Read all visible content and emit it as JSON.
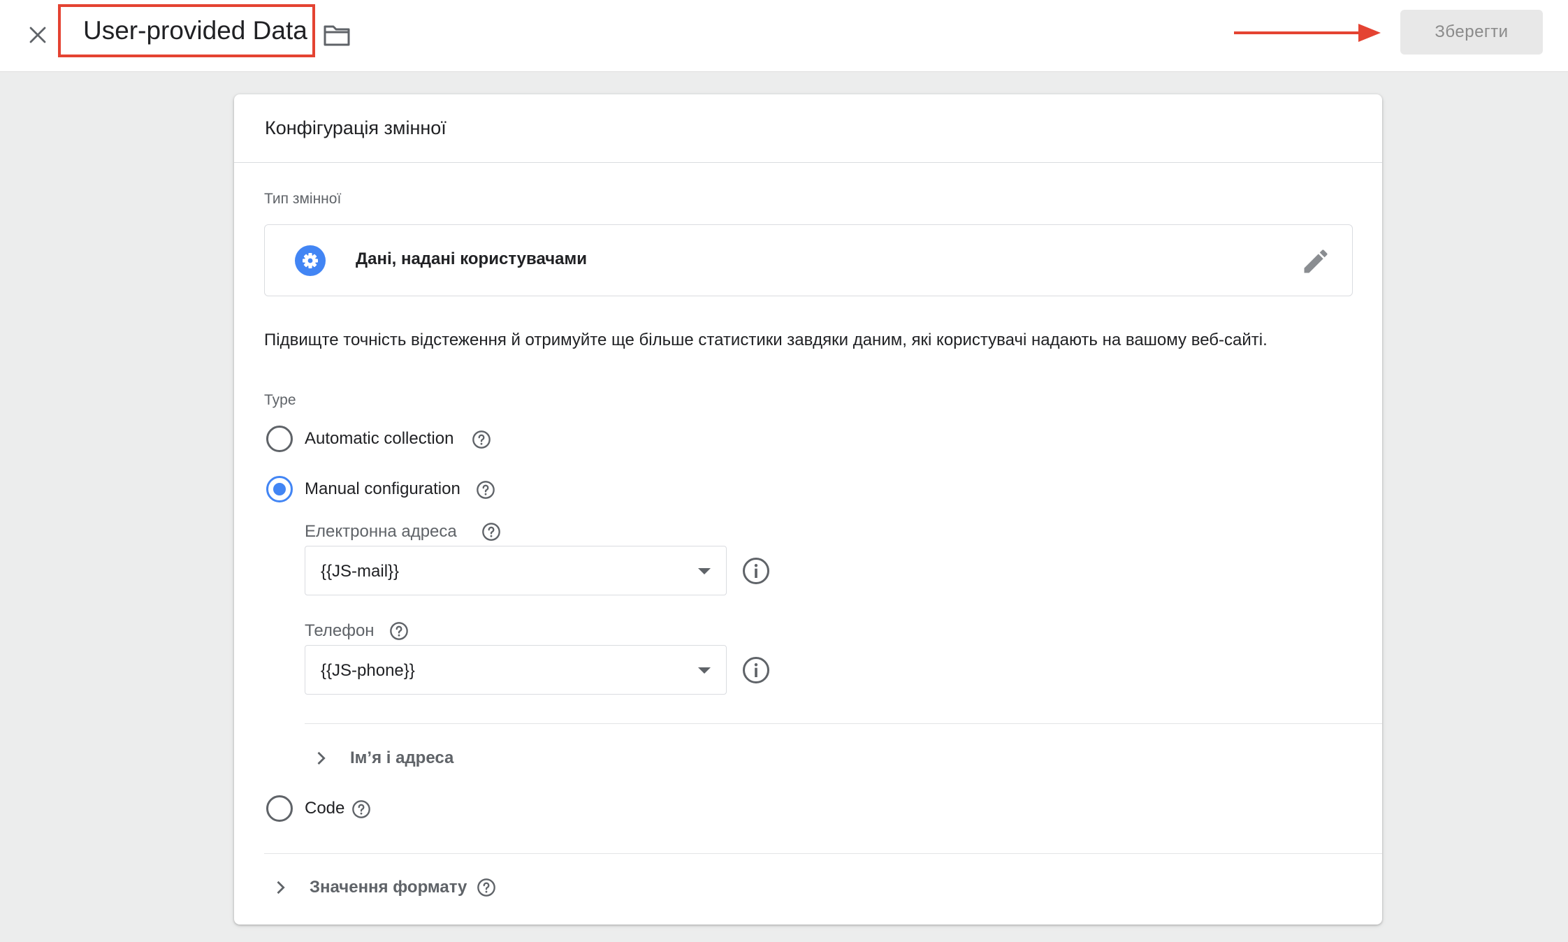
{
  "topbar": {
    "title": "User-provided Data",
    "save_label": "Зберегти",
    "close_icon": "close-icon",
    "folder_icon": "folder-icon",
    "annotation_color": "#e44332"
  },
  "card": {
    "header_title": "Конфігурація змінної",
    "variable_type_label": "Тип змінної",
    "variable_type_value": "Дані, надані користувачами",
    "description": "Підвищте точність відстеження й отримуйте ще більше статистики завдяки даним, які користувачі надають на вашому веб-сайті.",
    "type_label": "Type",
    "options": [
      {
        "label": "Automatic collection",
        "checked": false
      },
      {
        "label": "Manual configuration",
        "checked": true
      },
      {
        "label": "Code",
        "checked": false
      }
    ],
    "manual": {
      "email_label": "Електронна адреса",
      "email_value": "{{JS-mail}}",
      "phone_label": "Телефон",
      "phone_value": "{{JS-phone}}",
      "name_address_label": "Ім’я і адреса"
    },
    "format_values_label": "Значення формату"
  },
  "colors": {
    "accent": "#4285f4",
    "text": "#202124",
    "secondary_text": "#5f6368"
  }
}
